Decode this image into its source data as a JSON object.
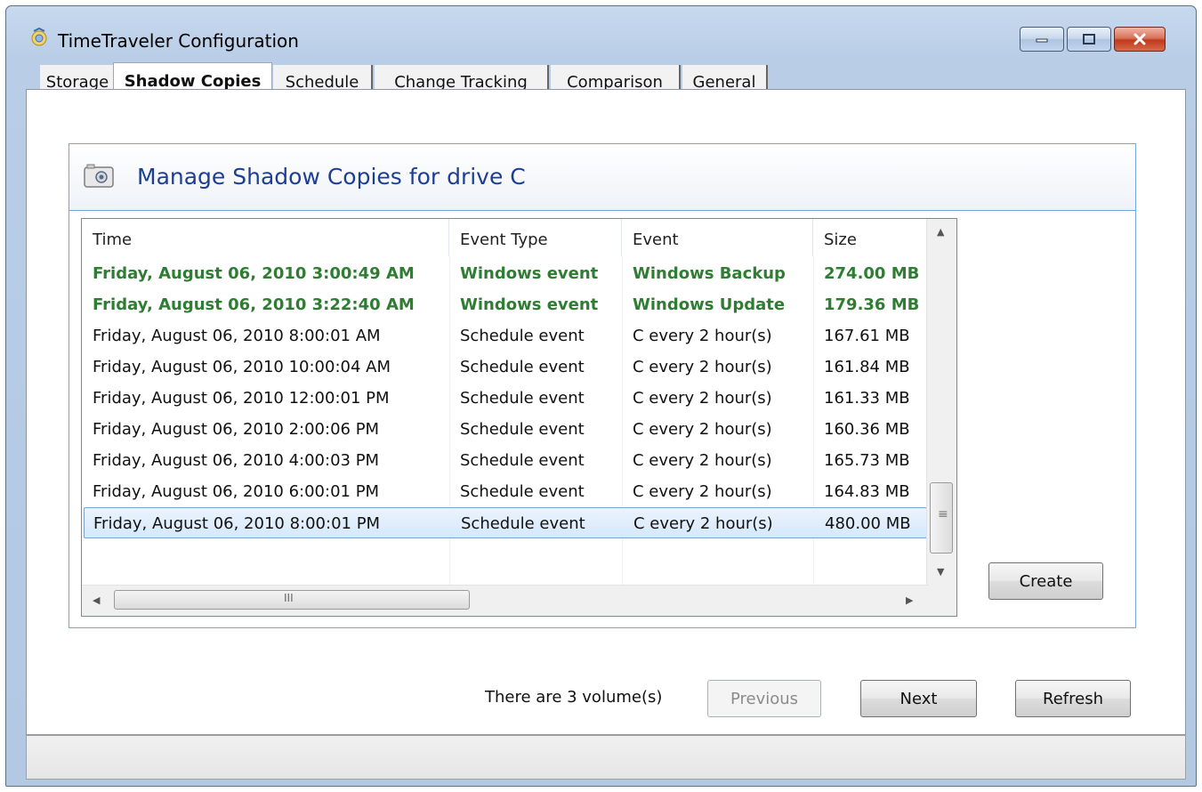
{
  "window": {
    "title": "TimeTraveler Configuration",
    "icon": "timetraveler-app-icon"
  },
  "tabs": [
    {
      "label": "Storage",
      "active": false
    },
    {
      "label": "Shadow Copies",
      "active": true
    },
    {
      "label": "Schedule",
      "active": false
    },
    {
      "label": "Change Tracking",
      "active": false
    },
    {
      "label": "Comparison",
      "active": false
    },
    {
      "label": "General",
      "active": false
    }
  ],
  "panel": {
    "title": "Manage Shadow Copies for drive C",
    "icon": "camera-icon"
  },
  "list": {
    "columns": [
      "Time",
      "Event Type",
      "Event",
      "Size"
    ],
    "rows": [
      {
        "time": "Friday, August 06, 2010 3:00:49 AM",
        "type": "Windows event",
        "event": "Windows Backup",
        "size": "274.00 MB",
        "highlight": true
      },
      {
        "time": "Friday, August 06, 2010 3:22:40 AM",
        "type": "Windows event",
        "event": "Windows Update",
        "size": "179.36 MB",
        "highlight": true
      },
      {
        "time": "Friday, August 06, 2010 8:00:01 AM",
        "type": "Schedule event",
        "event": "C every 2 hour(s)",
        "size": "167.61 MB"
      },
      {
        "time": "Friday, August 06, 2010 10:00:04 AM",
        "type": "Schedule event",
        "event": "C every 2 hour(s)",
        "size": "161.84 MB"
      },
      {
        "time": "Friday, August 06, 2010 12:00:01 PM",
        "type": "Schedule event",
        "event": "C every 2 hour(s)",
        "size": "161.33 MB"
      },
      {
        "time": "Friday, August 06, 2010 2:00:06 PM",
        "type": "Schedule event",
        "event": "C every 2 hour(s)",
        "size": "160.36 MB"
      },
      {
        "time": "Friday, August 06, 2010 4:00:03 PM",
        "type": "Schedule event",
        "event": "C every 2 hour(s)",
        "size": "165.73 MB"
      },
      {
        "time": "Friday, August 06, 2010 6:00:01 PM",
        "type": "Schedule event",
        "event": "C every 2 hour(s)",
        "size": "164.83 MB"
      },
      {
        "time": "Friday, August 06, 2010 8:00:01 PM",
        "type": "Schedule event",
        "event": "C every 2 hour(s)",
        "size": "480.00 MB",
        "selected": true
      }
    ],
    "highlight_color": "#2e7d32"
  },
  "buttons": {
    "create": "Create",
    "previous": "Previous",
    "next": "Next",
    "refresh": "Refresh"
  },
  "footer": {
    "volume_text": "There are 3 volume(s)"
  },
  "scrollbar": {
    "grip": "≡",
    "hgrip": "III"
  }
}
